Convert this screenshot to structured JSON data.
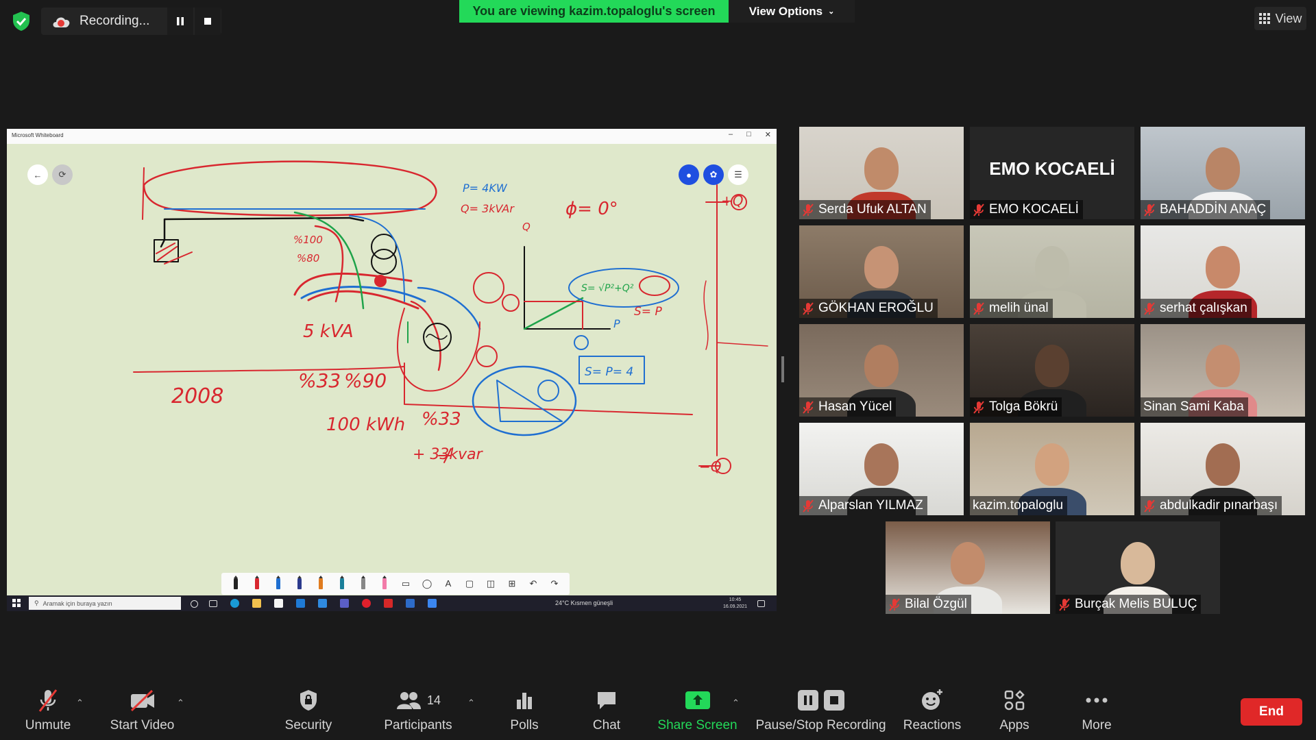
{
  "top_bar": {
    "security_badge_icon": "shield-check-icon",
    "recording_label": "Recording...",
    "viewing_banner": "You are viewing kazim.topaloglu's screen",
    "view_options_label": "View Options",
    "view_label": "View"
  },
  "shared_screen": {
    "window_title": "Microsoft Whiteboard",
    "drawing_text": {
      "p4kw": "P= 4KW",
      "q3kvar": "Q= 3kVAr",
      "phi": "ϕ= 0°",
      "q_axis": "Q",
      "p_axis": "P",
      "s_p": "S= P",
      "s_eq": "S= √P²+Q²",
      "s_p4": "S= P= 4",
      "pct100": "%100",
      "pct80": "%80",
      "kva": "5 kVA",
      "year": "2008",
      "pct33": "%33",
      "pct90": "%90",
      "kwh": "100 kWh",
      "pct33b": "%33",
      "kvar33": "+ 33kvar",
      "plus_q": "+Q",
      "minus_q": "−Q"
    },
    "taskbar": {
      "search_placeholder": "Aramak için buraya yazın",
      "weather": "24°C  Kısmen güneşli",
      "time": "10:45",
      "date": "16.09.2021"
    }
  },
  "participants": [
    {
      "name": "Serda Ufuk ALTAN",
      "muted": true,
      "video": true
    },
    {
      "name": "EMO KOCAELİ",
      "muted": true,
      "video": false,
      "display_text": "EMO KOCAELİ"
    },
    {
      "name": "BAHADDİN ANAÇ",
      "muted": true,
      "video": true
    },
    {
      "name": "GÖKHAN EROĞLU",
      "muted": true,
      "video": true
    },
    {
      "name": "melih ünal",
      "muted": true,
      "video": true
    },
    {
      "name": "serhat çalışkan",
      "muted": true,
      "video": true
    },
    {
      "name": "Hasan Yücel",
      "muted": true,
      "video": true
    },
    {
      "name": "Tolga Bökrü",
      "muted": true,
      "video": true
    },
    {
      "name": "Sinan Sami Kaba",
      "muted": false,
      "video": true
    },
    {
      "name": "Alparslan YILMAZ",
      "muted": true,
      "video": true
    },
    {
      "name": "kazim.topaloglu",
      "muted": false,
      "video": true,
      "active_speaker": true
    },
    {
      "name": "abdulkadir pınarbaşı",
      "muted": true,
      "video": true
    },
    {
      "name": "Bilal Özgül",
      "muted": true,
      "video": true
    },
    {
      "name": "Burçak Melis BULUÇ",
      "muted": true,
      "video": true
    }
  ],
  "toolbar": {
    "unmute": "Unmute",
    "start_video": "Start Video",
    "security": "Security",
    "participants": "Participants",
    "participant_count": "14",
    "polls": "Polls",
    "chat": "Chat",
    "share_screen": "Share Screen",
    "pause_stop_recording": "Pause/Stop Recording",
    "reactions": "Reactions",
    "apps": "Apps",
    "more": "More",
    "end": "End"
  },
  "colors": {
    "banner_green": "#23d959",
    "share_green": "#23d959",
    "end_red": "#e02828",
    "active_speaker": "#e9ec6e",
    "mute_red": "#e53935",
    "whiteboard_bg": "#dfe8cb",
    "ink_red": "#d8272f",
    "ink_blue": "#1f6fd1",
    "ink_green": "#1fa34a"
  }
}
